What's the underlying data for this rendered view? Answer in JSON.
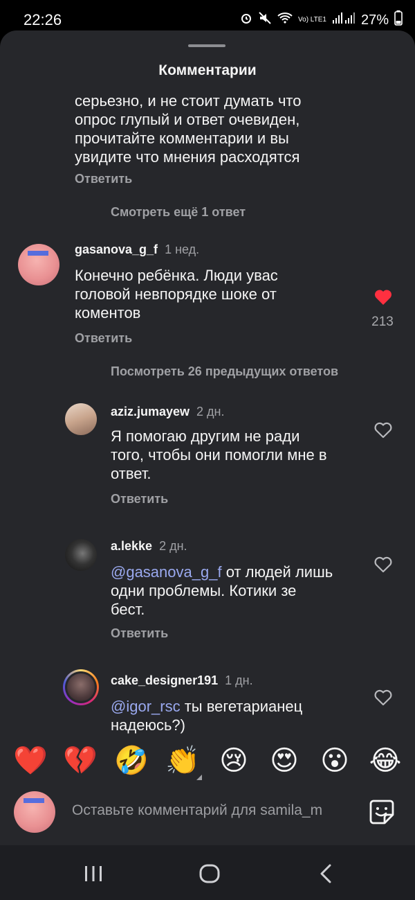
{
  "status_bar": {
    "time": "22:26",
    "battery": "27%",
    "network": "Vo) LTE1"
  },
  "sheet": {
    "title": "Комментарии"
  },
  "comments": {
    "c0": {
      "lines": [
        "серьезно, и не стоит думать что",
        "опрос глупый и ответ очевиден,",
        "прочитайте комментарии и вы",
        "увидите что мнения расходятся"
      ],
      "reply": "Ответить"
    },
    "more1": "Смотреть ещё 1 ответ",
    "c1": {
      "username": "gasanova_g_f",
      "time": "1 нед.",
      "lines": [
        "Конечно ребёнка.  Люди увас",
        "головой невпорядке шоке от",
        "коментов"
      ],
      "likes": "213",
      "reply": "Ответить"
    },
    "more2": "Посмотреть 26 предыдущих ответов",
    "r1": {
      "username": "aziz.jumayew",
      "time": "2 дн.",
      "lines": [
        "Я помогаю другим не ради",
        "того, чтобы они помогли мне в",
        "ответ."
      ],
      "reply": "Ответить"
    },
    "r2": {
      "username": "a.lekke",
      "time": "2 дн.",
      "mention": "@gasanova_g_f",
      "line1_rest": " от людей лишь",
      "lines": [
        "одни проблемы. Котики зе",
        "бест."
      ],
      "reply": "Ответить"
    },
    "r3": {
      "username": "cake_designer191",
      "time": "1 дн.",
      "mention": "@igor_rsc",
      "line1_rest": " ты вегетарианец",
      "lines": [
        "надеюсь?)"
      ]
    }
  },
  "reactions": [
    "❤️",
    "💔",
    "🤣",
    "👏",
    "😢",
    "😍",
    "😮",
    "😂"
  ],
  "composer": {
    "placeholder": "Оставьте комментарий для samila_m"
  },
  "icons": {
    "liked": "heart-filled-icon",
    "unliked": "heart-outline-icon",
    "sticker": "sticker-icon"
  },
  "colors": {
    "like_red": "#ff3040",
    "mention": "#9aa9ef",
    "sheet_bg": "#26272b"
  }
}
